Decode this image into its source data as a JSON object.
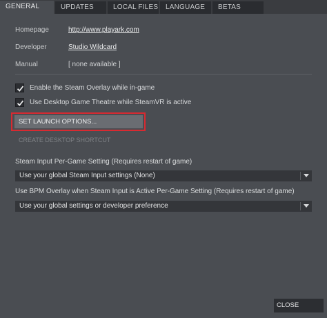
{
  "tabs": [
    {
      "label": "GENERAL"
    },
    {
      "label": "UPDATES"
    },
    {
      "label": "LOCAL FILES"
    },
    {
      "label": "LANGUAGE"
    },
    {
      "label": "BETAS"
    }
  ],
  "info": {
    "homepage_label": "Homepage",
    "homepage_value": "http://www.playark.com",
    "developer_label": "Developer",
    "developer_value": "Studio Wildcard",
    "manual_label": "Manual",
    "manual_value": "[ none available ]"
  },
  "options": {
    "overlay_label": "Enable the Steam Overlay while in-game",
    "overlay_checked": true,
    "theatre_label": "Use Desktop Game Theatre while SteamVR is active",
    "theatre_checked": true
  },
  "buttons": {
    "launch_options": "SET LAUNCH OPTIONS...",
    "desktop_shortcut": "CREATE DESKTOP SHORTCUT",
    "close": "CLOSE"
  },
  "steam_input": {
    "title": "Steam Input Per-Game Setting (Requires restart of game)",
    "selected": "Use your global Steam Input settings (None)"
  },
  "bpm_overlay": {
    "title": "Use BPM Overlay when Steam Input is Active Per-Game Setting (Requires restart of game)",
    "selected": "Use your global settings or developer preference"
  },
  "colors": {
    "background": "#4a4d52",
    "highlight_box": "#d92a31",
    "button": "#6a6d72"
  }
}
